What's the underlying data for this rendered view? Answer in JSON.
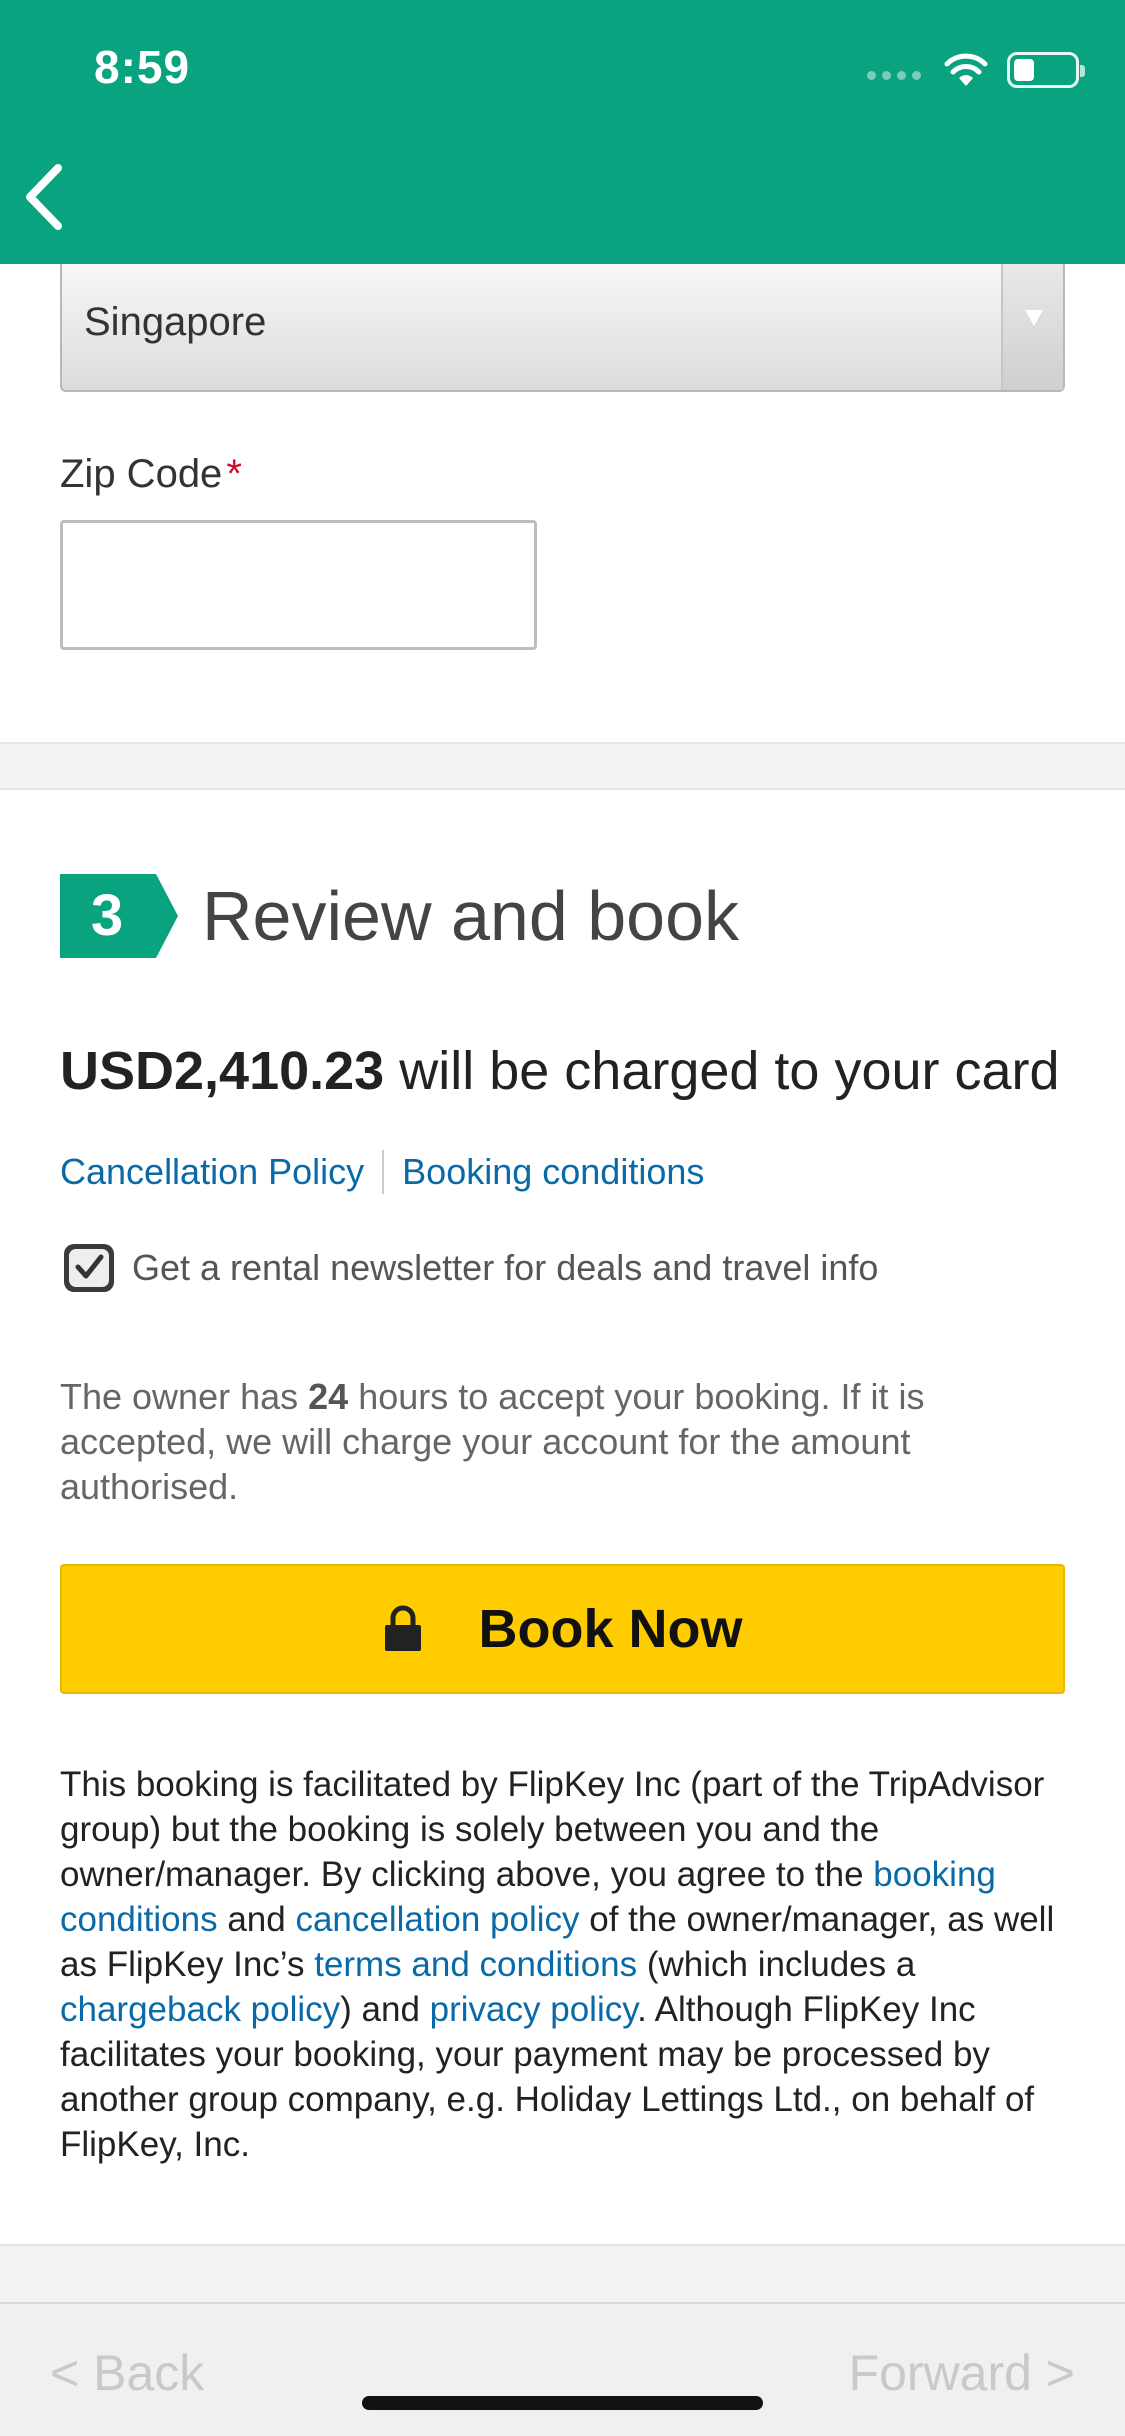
{
  "status_bar": {
    "time": "8:59"
  },
  "form": {
    "country_value": "Singapore",
    "zip_label": "Zip Code",
    "zip_required_mark": "*",
    "zip_value": ""
  },
  "review": {
    "step_number": "3",
    "title": "Review and book",
    "amount": "USD2,410.23",
    "charge_suffix": " will be charged to your card",
    "links": [
      "Cancellation Policy",
      "Booking conditions"
    ],
    "newsletter_label": "Get a rental newsletter for deals and travel info",
    "newsletter_checked": true,
    "owner_note_pre": "The owner has ",
    "owner_note_hours": "24",
    "owner_note_post": " hours to accept your booking. If it is accepted, we will charge your account for the amount authorised.",
    "book_button_label": "Book Now"
  },
  "legal": {
    "t1": "This booking is facilitated by FlipKey Inc (part of the TripAdvisor group) but the booking is solely between you and the owner/manager. By clicking above, you agree to the ",
    "link_booking_conditions": "booking conditions",
    "t2": " and ",
    "link_cancellation_policy": "cancellation policy",
    "t3": " of the owner/manager, as well as FlipKey Inc’s ",
    "link_terms": "terms and conditions",
    "t4": " (which includes a ",
    "link_chargeback": "chargeback policy",
    "t5": ") and ",
    "link_privacy": "privacy policy",
    "t6": ". Although FlipKey Inc facilitates your booking, your payment may be processed by another group company, e.g. Holiday Lettings Ltd., on behalf of FlipKey, Inc."
  },
  "browser_nav": {
    "back": "< Back",
    "forward": "Forward >"
  },
  "colors": {
    "header": "#0aa37f",
    "link": "#0a6aa8",
    "book_button": "#ffcc00",
    "required": "#c8102e"
  },
  "icons": [
    "back-chevron-icon",
    "wifi-icon",
    "battery-icon",
    "dropdown-arrow-icon",
    "check-icon",
    "lock-icon"
  ]
}
